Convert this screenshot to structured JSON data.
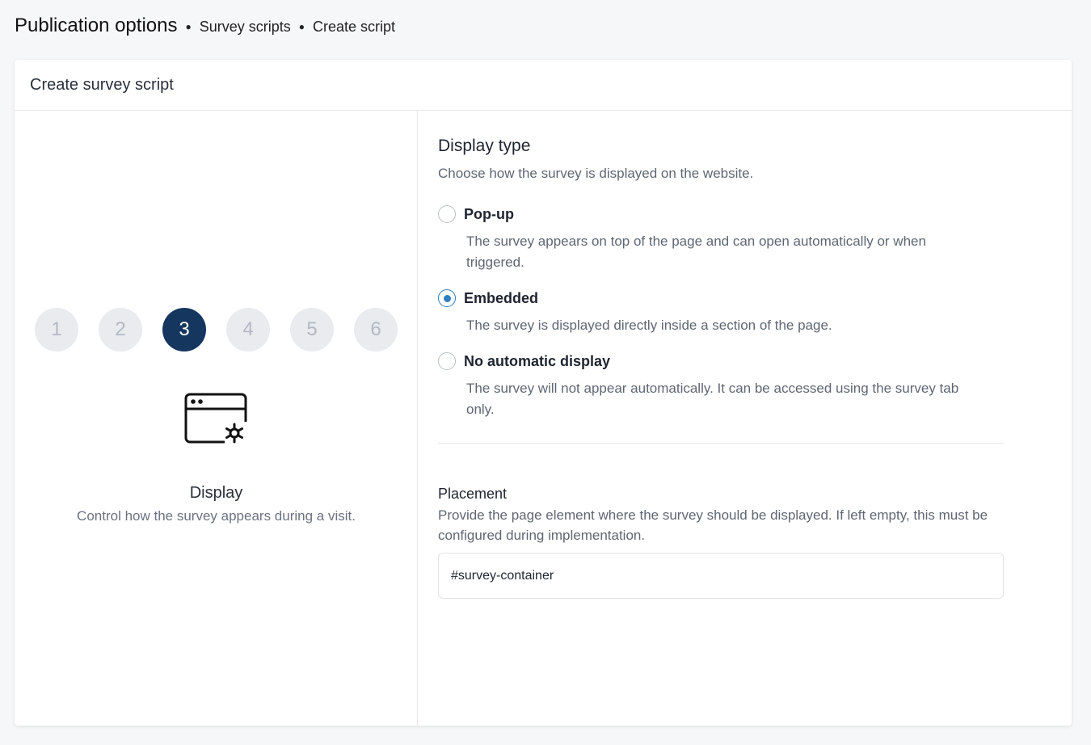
{
  "breadcrumb": {
    "root": "Publication options",
    "items": [
      "Survey scripts",
      "Create script"
    ]
  },
  "card": {
    "title": "Create survey script"
  },
  "stepper": {
    "steps": [
      "1",
      "2",
      "3",
      "4",
      "5",
      "6"
    ],
    "active_step": 3,
    "current": {
      "icon": "browser-settings-icon",
      "title": "Display",
      "description": "Control how the survey appears during a visit."
    }
  },
  "display_type": {
    "title": "Display type",
    "subtitle": "Choose how the survey is displayed on the website.",
    "options": [
      {
        "label": "Pop-up",
        "description": "The survey appears on top of the page and can open automatically or when triggered.",
        "selected": false
      },
      {
        "label": "Embedded",
        "description": "The survey is displayed directly inside a section of the page.",
        "selected": true
      },
      {
        "label": "No automatic display",
        "description": "The survey will not appear automatically. It can be accessed using the survey tab only.",
        "selected": false
      }
    ]
  },
  "placement": {
    "label": "Placement",
    "description": "Provide the page element where the survey should be displayed. If left empty, this must be configured during implementation.",
    "value": "#survey-container"
  },
  "colors": {
    "active_step": "#14365f",
    "radio_selected": "#2f7fc1",
    "inactive_step": "#e9ebef"
  }
}
